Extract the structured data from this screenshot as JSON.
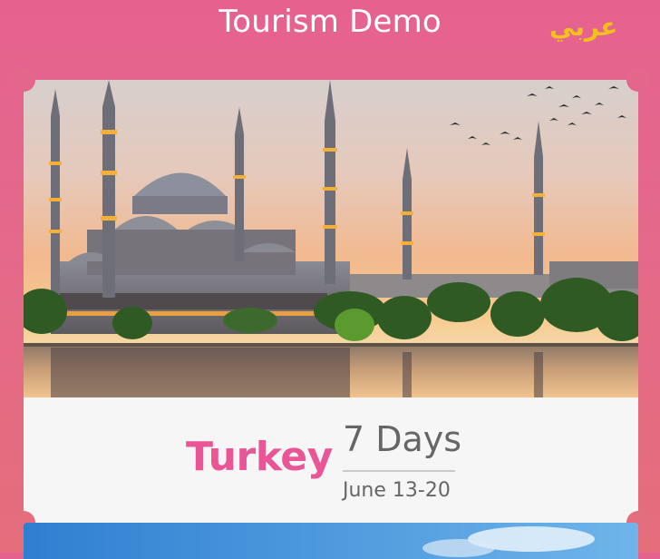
{
  "header": {
    "title": "Tourism Demo",
    "language_toggle": "عربي"
  },
  "trips": [
    {
      "country": "Turkey",
      "duration": "7 Days",
      "dates": "June 13-20"
    }
  ],
  "colors": {
    "background": "#e5668a",
    "accent_pink": "#e95595",
    "language_yellow": "#f2c21b",
    "card_bg": "#f6f6f6",
    "text_gray": "#666666"
  }
}
